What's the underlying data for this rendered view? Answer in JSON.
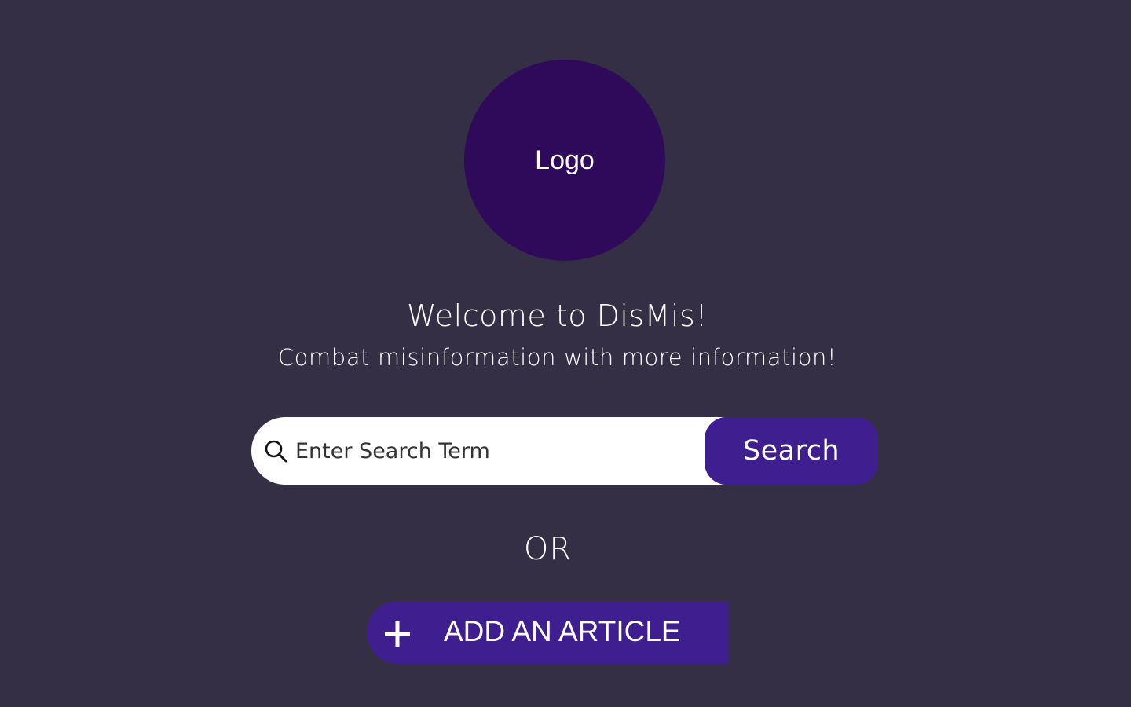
{
  "logo": {
    "label": "Logo"
  },
  "hero": {
    "title": "Welcome to DisMis!",
    "subtitle": "Combat misinformation with more information!"
  },
  "search": {
    "placeholder": "Enter Search Term",
    "value": "",
    "button_label": "Search",
    "icon": "search-icon"
  },
  "divider": {
    "text": "OR"
  },
  "add_article": {
    "label": "ADD AN ARTICLE",
    "icon": "plus-icon"
  },
  "colors": {
    "background": "#342f45",
    "logo_circle": "#300a5a",
    "accent": "#3f1f8f",
    "text": "#ffffff",
    "input_background": "#ffffff",
    "input_text": "#333333"
  }
}
